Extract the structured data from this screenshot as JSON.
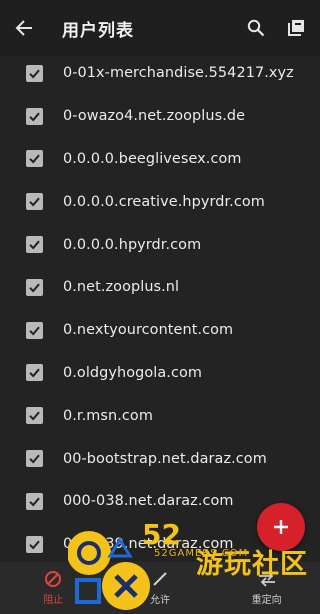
{
  "header": {
    "title": "用户列表",
    "back_icon": "arrow-left-icon",
    "search_icon": "search-icon",
    "copy_icon": "copy-icon"
  },
  "list": {
    "items": [
      {
        "label": "0-01x-merchandise.554217.xyz",
        "checked": true
      },
      {
        "label": "0-owazo4.net.zooplus.de",
        "checked": true
      },
      {
        "label": "0.0.0.0.beeglivesex.com",
        "checked": true
      },
      {
        "label": "0.0.0.0.creative.hpyrdr.com",
        "checked": true
      },
      {
        "label": "0.0.0.0.hpyrdr.com",
        "checked": true
      },
      {
        "label": "0.net.zooplus.nl",
        "checked": true
      },
      {
        "label": "0.nextyourcontent.com",
        "checked": true
      },
      {
        "label": "0.oldgyhogola.com",
        "checked": true
      },
      {
        "label": "0.r.msn.com",
        "checked": true
      },
      {
        "label": "00-bootstrap.net.daraz.com",
        "checked": true
      },
      {
        "label": "000-038.net.daraz.com",
        "checked": true
      },
      {
        "label": "000-039.net.daraz.com",
        "checked": true
      }
    ]
  },
  "fab": {
    "icon": "plus-icon",
    "color": "#d6212a"
  },
  "bottom_bar": {
    "tabs": [
      {
        "label": "阻止",
        "icon": "block-icon",
        "color": "#e0453b"
      },
      {
        "label": "允许",
        "icon": "allow-icon",
        "color": "#cfcfcf"
      },
      {
        "label": "重定向",
        "icon": "redirect-icon",
        "color": "#cfcfcf"
      }
    ]
  },
  "watermark": {
    "number": "52",
    "text": "游玩社区",
    "domain": "52GAMERS.COM"
  },
  "colors": {
    "background": "#232323",
    "appbar": "#1f1f1f",
    "bottom_bar": "#2a2a2a",
    "checkbox": "#b9b9b9",
    "accent_red": "#d6212a",
    "watermark_yellow": "#f3c21b"
  }
}
